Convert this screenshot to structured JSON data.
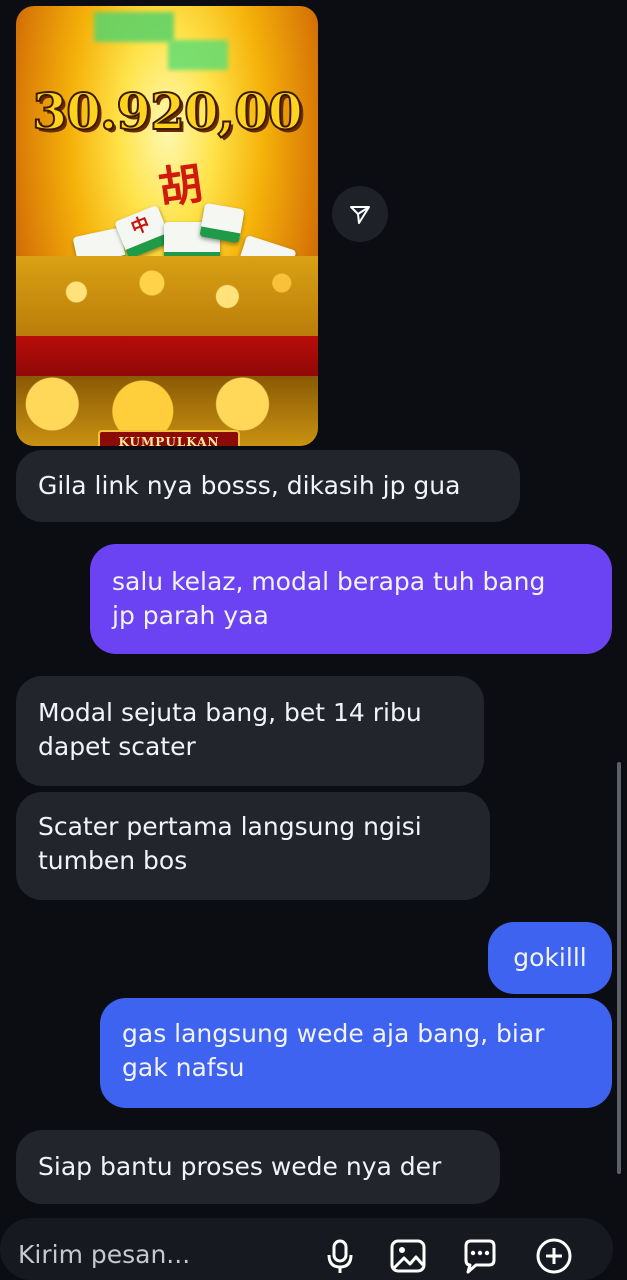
{
  "shared_image": {
    "amount": "30.920,00",
    "glyph": "胡",
    "glyph_small": "中",
    "collect_label": "KUMPULKAN"
  },
  "messages": [
    {
      "side": "received",
      "text_lines": [
        "Gila link nya bosss, dikasih jp gua"
      ]
    },
    {
      "side": "sent",
      "text_lines": [
        "salu kelaz, modal berapa tuh bang",
        "jp parah yaa"
      ]
    },
    {
      "side": "received",
      "text_lines": [
        "Modal sejuta bang, bet 14 ribu",
        "dapet scater"
      ]
    },
    {
      "side": "received",
      "text_lines": [
        "Scater pertama langsung ngisi",
        "tumben bos"
      ]
    },
    {
      "side": "sent",
      "text_lines": [
        "gokilll"
      ]
    },
    {
      "side": "sent",
      "text_lines": [
        "gas langsung wede aja bang, biar",
        "gak nafsu"
      ]
    },
    {
      "side": "received",
      "text_lines": [
        "Siap bantu proses wede nya der"
      ]
    }
  ],
  "composer": {
    "placeholder": "Kirim pesan...",
    "icons": [
      "microphone-icon",
      "image-icon",
      "sticker-icon",
      "plus-icon"
    ]
  },
  "colors": {
    "background": "#0b0d12",
    "received_bubble": "#22252c",
    "sent_purple": "#6c43f2",
    "sent_blue": "#3e63f0"
  }
}
